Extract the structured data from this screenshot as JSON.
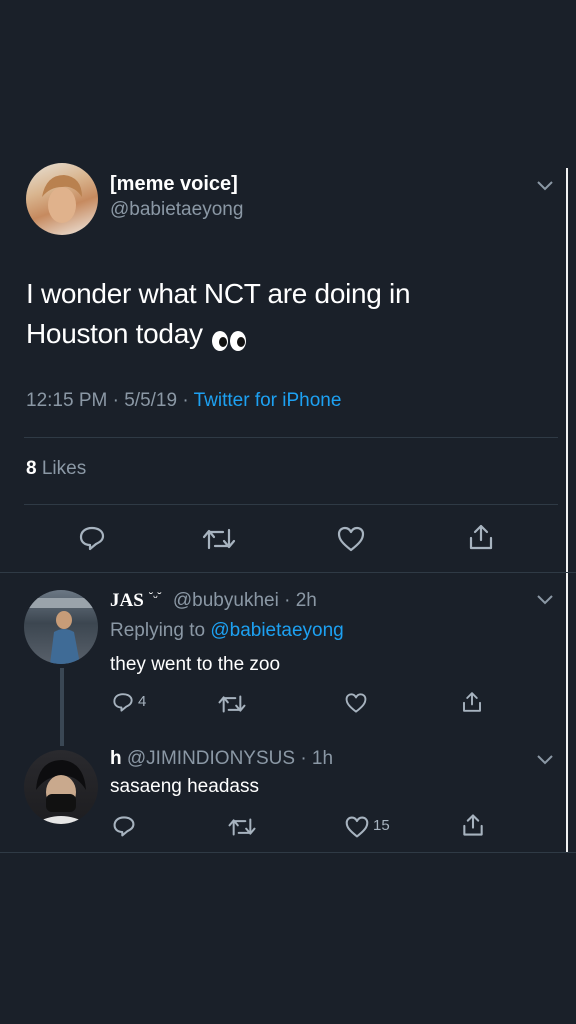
{
  "main_tweet": {
    "display_name": "[meme voice]",
    "handle": "@babietaeyong",
    "text_line1": "I wonder what NCT are doing in",
    "text_line2": "Houston today",
    "emoji": "👀",
    "time": "12:15 PM",
    "date": "5/5/19",
    "source": "Twitter for iPhone",
    "like_count": "8",
    "like_label": "Likes"
  },
  "replies": [
    {
      "display_name": "JAS",
      "name_emoji": "˘ᵕ˘",
      "handle": "@bubyukhei",
      "time": "2h",
      "replying_label": "Replying to",
      "replying_to": "@babietaeyong",
      "text": "they went to the zoo",
      "reply_count": "4"
    },
    {
      "display_name": "h",
      "handle": "@JIMINDIONYSUS",
      "time": "1h",
      "text": "sasaeng headass",
      "like_count": "15"
    }
  ],
  "colors": {
    "background": "#1a2029",
    "accent": "#1da1f2",
    "muted": "#8b98a5",
    "divider": "#2f3a45"
  },
  "icons": [
    "chevron-down-icon",
    "reply-icon",
    "retweet-icon",
    "heart-icon",
    "share-icon",
    "eyes-emoji"
  ]
}
